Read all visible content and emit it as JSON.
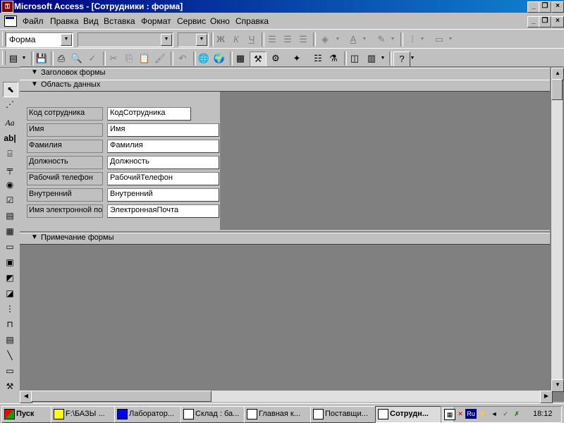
{
  "window": {
    "title": "Microsoft Access - [Сотрудники : форма]"
  },
  "menu": [
    "Файл",
    "Правка",
    "Вид",
    "Вставка",
    "Формат",
    "Сервис",
    "Окно",
    "Справка"
  ],
  "toolbar": {
    "object_combo": "Форма",
    "font_combo": "",
    "size_combo": "",
    "bold": "Ж",
    "italic": "К",
    "underline": "Ч"
  },
  "sections": {
    "header": "Заголовок формы",
    "detail": "Область данных",
    "footer": "Примечание формы"
  },
  "fields": [
    {
      "label": "Код сотрудника",
      "control": "КодСотрудника"
    },
    {
      "label": "Имя",
      "control": "Имя"
    },
    {
      "label": "Фамилия",
      "control": "Фамилия"
    },
    {
      "label": "Должность",
      "control": "Должность"
    },
    {
      "label": "Рабочий телефон",
      "control": "РабочийТелефон"
    },
    {
      "label": "Внутренний",
      "control": "Внутренний"
    },
    {
      "label": "Имя электронной по",
      "control": "ЭлектроннаяПочта"
    }
  ],
  "taskbar": {
    "start": "Пуск",
    "tasks": [
      {
        "label": "F:\\БАЗЫ ...",
        "icon": "folder-icon"
      },
      {
        "label": "Лаборатор...",
        "icon": "word-icon"
      },
      {
        "label": "Склад : ба...",
        "icon": "database-icon"
      },
      {
        "label": "Главная к...",
        "icon": "form-icon"
      },
      {
        "label": "Поставщи...",
        "icon": "form-icon"
      },
      {
        "label": "Сотрудн...",
        "icon": "form-icon",
        "active": true
      }
    ],
    "lang": "Ru",
    "clock": "18:12"
  },
  "colors": {
    "titlebar": "#000080",
    "workspace": "#808080",
    "face": "#c0c0c0"
  }
}
